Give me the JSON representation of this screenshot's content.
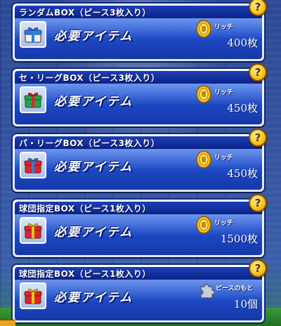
{
  "shop": {
    "required_label": "必要アイテム",
    "help_symbol": "?",
    "items": [
      {
        "title": "ランダムBOX（ピース3枚入り）",
        "currency": "リッチ",
        "cost": "400枚",
        "box_color": "#2f7fd8",
        "ribbon_color": "#f2f2f2",
        "currency_icon": "rich-coin-icon"
      },
      {
        "title": "セ・リーグBOX（ピース3枚入り）",
        "currency": "リッチ",
        "cost": "450枚",
        "box_color": "#2aa04a",
        "ribbon_color": "#d8262b",
        "currency_icon": "rich-coin-icon"
      },
      {
        "title": "パ・リーグBOX（ピース3枚入り）",
        "currency": "リッチ",
        "cost": "450枚",
        "box_color": "#d8262b",
        "ribbon_color": "#2f7fd8",
        "currency_icon": "rich-coin-icon"
      },
      {
        "title": "球団指定BOX（ピース1枚入り）",
        "currency": "リッチ",
        "cost": "1500枚",
        "box_color": "#d8262b",
        "ribbon_color": "#f0c21a",
        "currency_icon": "rich-coin-icon"
      },
      {
        "title": "球団指定BOX（ピース1枚入り）",
        "currency": "ピースのもと",
        "cost": "10個",
        "box_color": "#d8262b",
        "ribbon_color": "#f0c21a",
        "currency_icon": "puzzle-piece-icon"
      }
    ]
  }
}
